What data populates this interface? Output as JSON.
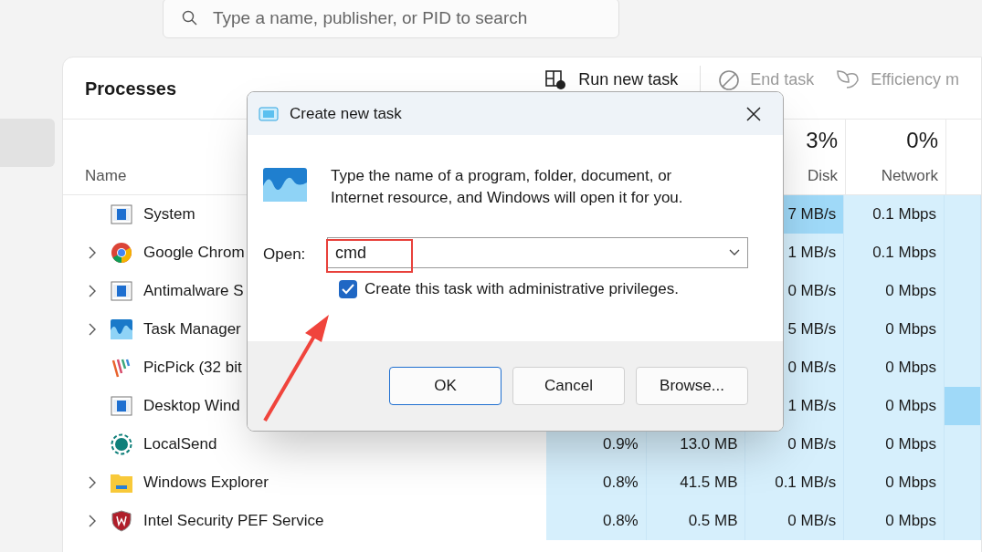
{
  "search": {
    "placeholder": "Type a name, publisher, or PID to search"
  },
  "sidebar": {
    "items": [
      {
        "selected": true
      }
    ]
  },
  "processes": {
    "title": "Processes",
    "toolbar": [
      {
        "label": "Run new task",
        "kind": "run",
        "disabled": false
      },
      {
        "label": "End task",
        "kind": "end",
        "disabled": true
      },
      {
        "label": "Efficiency m",
        "kind": "efficiency",
        "disabled": true
      }
    ],
    "name_header": "Name",
    "disk_header": {
      "percent": "3%",
      "label": "Disk"
    },
    "network_header": {
      "percent": "0%",
      "label": "Network"
    },
    "rows": [
      {
        "name": "System",
        "kind": "window",
        "expandable": false,
        "cells": [
          null,
          null,
          {
            "text": "7 MB/s",
            "highlighted": true
          },
          {
            "text": "0.1 Mbps",
            "highlighted": false
          },
          {
            "highlighted": false
          }
        ]
      },
      {
        "name": "Google Chrom",
        "kind": "chrome",
        "expandable": true,
        "cells": [
          null,
          null,
          {
            "text": "1 MB/s",
            "highlighted": false
          },
          {
            "text": "0.1 Mbps",
            "highlighted": false
          },
          {
            "highlighted": false
          }
        ]
      },
      {
        "name": "Antimalware S",
        "kind": "window",
        "expandable": true,
        "cells": [
          null,
          null,
          {
            "text": "0 MB/s",
            "highlighted": false
          },
          {
            "text": "0 Mbps",
            "highlighted": false
          },
          {
            "highlighted": false
          }
        ]
      },
      {
        "name": "Task Manager",
        "kind": "taskmanager",
        "expandable": true,
        "cells": [
          null,
          null,
          {
            "text": "5 MB/s",
            "highlighted": false
          },
          {
            "text": "0 Mbps",
            "highlighted": false
          },
          {
            "highlighted": false
          }
        ]
      },
      {
        "name": "PicPick (32 bit",
        "kind": "picpick",
        "expandable": false,
        "cells": [
          null,
          null,
          {
            "text": "0 MB/s",
            "highlighted": false
          },
          {
            "text": "0 Mbps",
            "highlighted": false
          },
          {
            "highlighted": false
          }
        ]
      },
      {
        "name": "Desktop Wind",
        "kind": "window",
        "expandable": false,
        "cells": [
          null,
          null,
          {
            "text": "1 MB/s",
            "highlighted": false
          },
          {
            "text": "0 Mbps",
            "highlighted": false
          },
          {
            "highlighted": true
          }
        ]
      },
      {
        "name": "LocalSend",
        "kind": "localsend",
        "expandable": false,
        "cells": [
          {
            "text": "0.9%",
            "highlighted": false
          },
          {
            "text": "13.0 MB",
            "highlighted": false
          },
          {
            "text": "0 MB/s",
            "highlighted": false
          },
          {
            "text": "0 Mbps",
            "highlighted": false
          },
          {
            "highlighted": false
          }
        ]
      },
      {
        "name": "Windows Explorer",
        "kind": "folder",
        "expandable": true,
        "cells": [
          {
            "text": "0.8%",
            "highlighted": false
          },
          {
            "text": "41.5 MB",
            "highlighted": false
          },
          {
            "text": "0.1 MB/s",
            "highlighted": false
          },
          {
            "text": "0 Mbps",
            "highlighted": false
          },
          {
            "highlighted": false
          }
        ]
      },
      {
        "name": "Intel Security PEF Service",
        "kind": "shield",
        "expandable": true,
        "cells": [
          {
            "text": "0.8%",
            "highlighted": false
          },
          {
            "text": "0.5 MB",
            "highlighted": false
          },
          {
            "text": "0 MB/s",
            "highlighted": false
          },
          {
            "text": "0 Mbps",
            "highlighted": false
          },
          {
            "highlighted": false
          }
        ]
      }
    ]
  },
  "dialog": {
    "title": "Create new task",
    "message": "Type the name of a program, folder, document, or Internet resource, and Windows will open it for you.",
    "open_label": "Open:",
    "open_value": "cmd",
    "admin_checkbox": {
      "label": "Create this task with administrative privileges.",
      "checked": true
    },
    "buttons": [
      {
        "label": "OK",
        "default": true
      },
      {
        "label": "Cancel",
        "default": false
      },
      {
        "label": "Browse...",
        "default": false
      }
    ]
  }
}
